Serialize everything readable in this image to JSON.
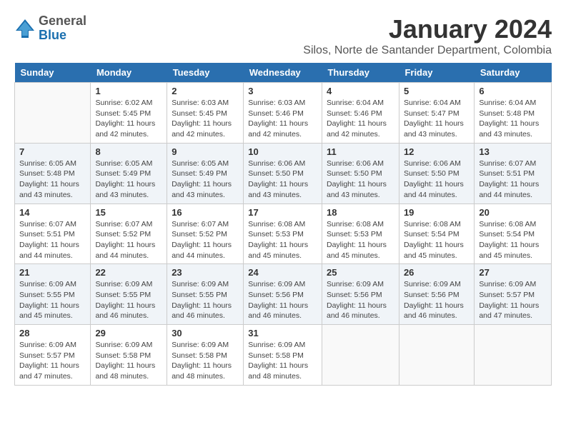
{
  "header": {
    "logo": {
      "general": "General",
      "blue": "Blue"
    },
    "title": "January 2024",
    "location": "Silos, Norte de Santander Department, Colombia"
  },
  "calendar": {
    "days_of_week": [
      "Sunday",
      "Monday",
      "Tuesday",
      "Wednesday",
      "Thursday",
      "Friday",
      "Saturday"
    ],
    "weeks": [
      [
        {
          "day": "",
          "info": ""
        },
        {
          "day": "1",
          "info": "Sunrise: 6:02 AM\nSunset: 5:45 PM\nDaylight: 11 hours\nand 42 minutes."
        },
        {
          "day": "2",
          "info": "Sunrise: 6:03 AM\nSunset: 5:45 PM\nDaylight: 11 hours\nand 42 minutes."
        },
        {
          "day": "3",
          "info": "Sunrise: 6:03 AM\nSunset: 5:46 PM\nDaylight: 11 hours\nand 42 minutes."
        },
        {
          "day": "4",
          "info": "Sunrise: 6:04 AM\nSunset: 5:46 PM\nDaylight: 11 hours\nand 42 minutes."
        },
        {
          "day": "5",
          "info": "Sunrise: 6:04 AM\nSunset: 5:47 PM\nDaylight: 11 hours\nand 43 minutes."
        },
        {
          "day": "6",
          "info": "Sunrise: 6:04 AM\nSunset: 5:48 PM\nDaylight: 11 hours\nand 43 minutes."
        }
      ],
      [
        {
          "day": "7",
          "info": "Sunrise: 6:05 AM\nSunset: 5:48 PM\nDaylight: 11 hours\nand 43 minutes."
        },
        {
          "day": "8",
          "info": "Sunrise: 6:05 AM\nSunset: 5:49 PM\nDaylight: 11 hours\nand 43 minutes."
        },
        {
          "day": "9",
          "info": "Sunrise: 6:05 AM\nSunset: 5:49 PM\nDaylight: 11 hours\nand 43 minutes."
        },
        {
          "day": "10",
          "info": "Sunrise: 6:06 AM\nSunset: 5:50 PM\nDaylight: 11 hours\nand 43 minutes."
        },
        {
          "day": "11",
          "info": "Sunrise: 6:06 AM\nSunset: 5:50 PM\nDaylight: 11 hours\nand 43 minutes."
        },
        {
          "day": "12",
          "info": "Sunrise: 6:06 AM\nSunset: 5:50 PM\nDaylight: 11 hours\nand 44 minutes."
        },
        {
          "day": "13",
          "info": "Sunrise: 6:07 AM\nSunset: 5:51 PM\nDaylight: 11 hours\nand 44 minutes."
        }
      ],
      [
        {
          "day": "14",
          "info": "Sunrise: 6:07 AM\nSunset: 5:51 PM\nDaylight: 11 hours\nand 44 minutes."
        },
        {
          "day": "15",
          "info": "Sunrise: 6:07 AM\nSunset: 5:52 PM\nDaylight: 11 hours\nand 44 minutes."
        },
        {
          "day": "16",
          "info": "Sunrise: 6:07 AM\nSunset: 5:52 PM\nDaylight: 11 hours\nand 44 minutes."
        },
        {
          "day": "17",
          "info": "Sunrise: 6:08 AM\nSunset: 5:53 PM\nDaylight: 11 hours\nand 45 minutes."
        },
        {
          "day": "18",
          "info": "Sunrise: 6:08 AM\nSunset: 5:53 PM\nDaylight: 11 hours\nand 45 minutes."
        },
        {
          "day": "19",
          "info": "Sunrise: 6:08 AM\nSunset: 5:54 PM\nDaylight: 11 hours\nand 45 minutes."
        },
        {
          "day": "20",
          "info": "Sunrise: 6:08 AM\nSunset: 5:54 PM\nDaylight: 11 hours\nand 45 minutes."
        }
      ],
      [
        {
          "day": "21",
          "info": "Sunrise: 6:09 AM\nSunset: 5:55 PM\nDaylight: 11 hours\nand 45 minutes."
        },
        {
          "day": "22",
          "info": "Sunrise: 6:09 AM\nSunset: 5:55 PM\nDaylight: 11 hours\nand 46 minutes."
        },
        {
          "day": "23",
          "info": "Sunrise: 6:09 AM\nSunset: 5:55 PM\nDaylight: 11 hours\nand 46 minutes."
        },
        {
          "day": "24",
          "info": "Sunrise: 6:09 AM\nSunset: 5:56 PM\nDaylight: 11 hours\nand 46 minutes."
        },
        {
          "day": "25",
          "info": "Sunrise: 6:09 AM\nSunset: 5:56 PM\nDaylight: 11 hours\nand 46 minutes."
        },
        {
          "day": "26",
          "info": "Sunrise: 6:09 AM\nSunset: 5:56 PM\nDaylight: 11 hours\nand 46 minutes."
        },
        {
          "day": "27",
          "info": "Sunrise: 6:09 AM\nSunset: 5:57 PM\nDaylight: 11 hours\nand 47 minutes."
        }
      ],
      [
        {
          "day": "28",
          "info": "Sunrise: 6:09 AM\nSunset: 5:57 PM\nDaylight: 11 hours\nand 47 minutes."
        },
        {
          "day": "29",
          "info": "Sunrise: 6:09 AM\nSunset: 5:58 PM\nDaylight: 11 hours\nand 48 minutes."
        },
        {
          "day": "30",
          "info": "Sunrise: 6:09 AM\nSunset: 5:58 PM\nDaylight: 11 hours\nand 48 minutes."
        },
        {
          "day": "31",
          "info": "Sunrise: 6:09 AM\nSunset: 5:58 PM\nDaylight: 11 hours\nand 48 minutes."
        },
        {
          "day": "",
          "info": ""
        },
        {
          "day": "",
          "info": ""
        },
        {
          "day": "",
          "info": ""
        }
      ]
    ]
  }
}
